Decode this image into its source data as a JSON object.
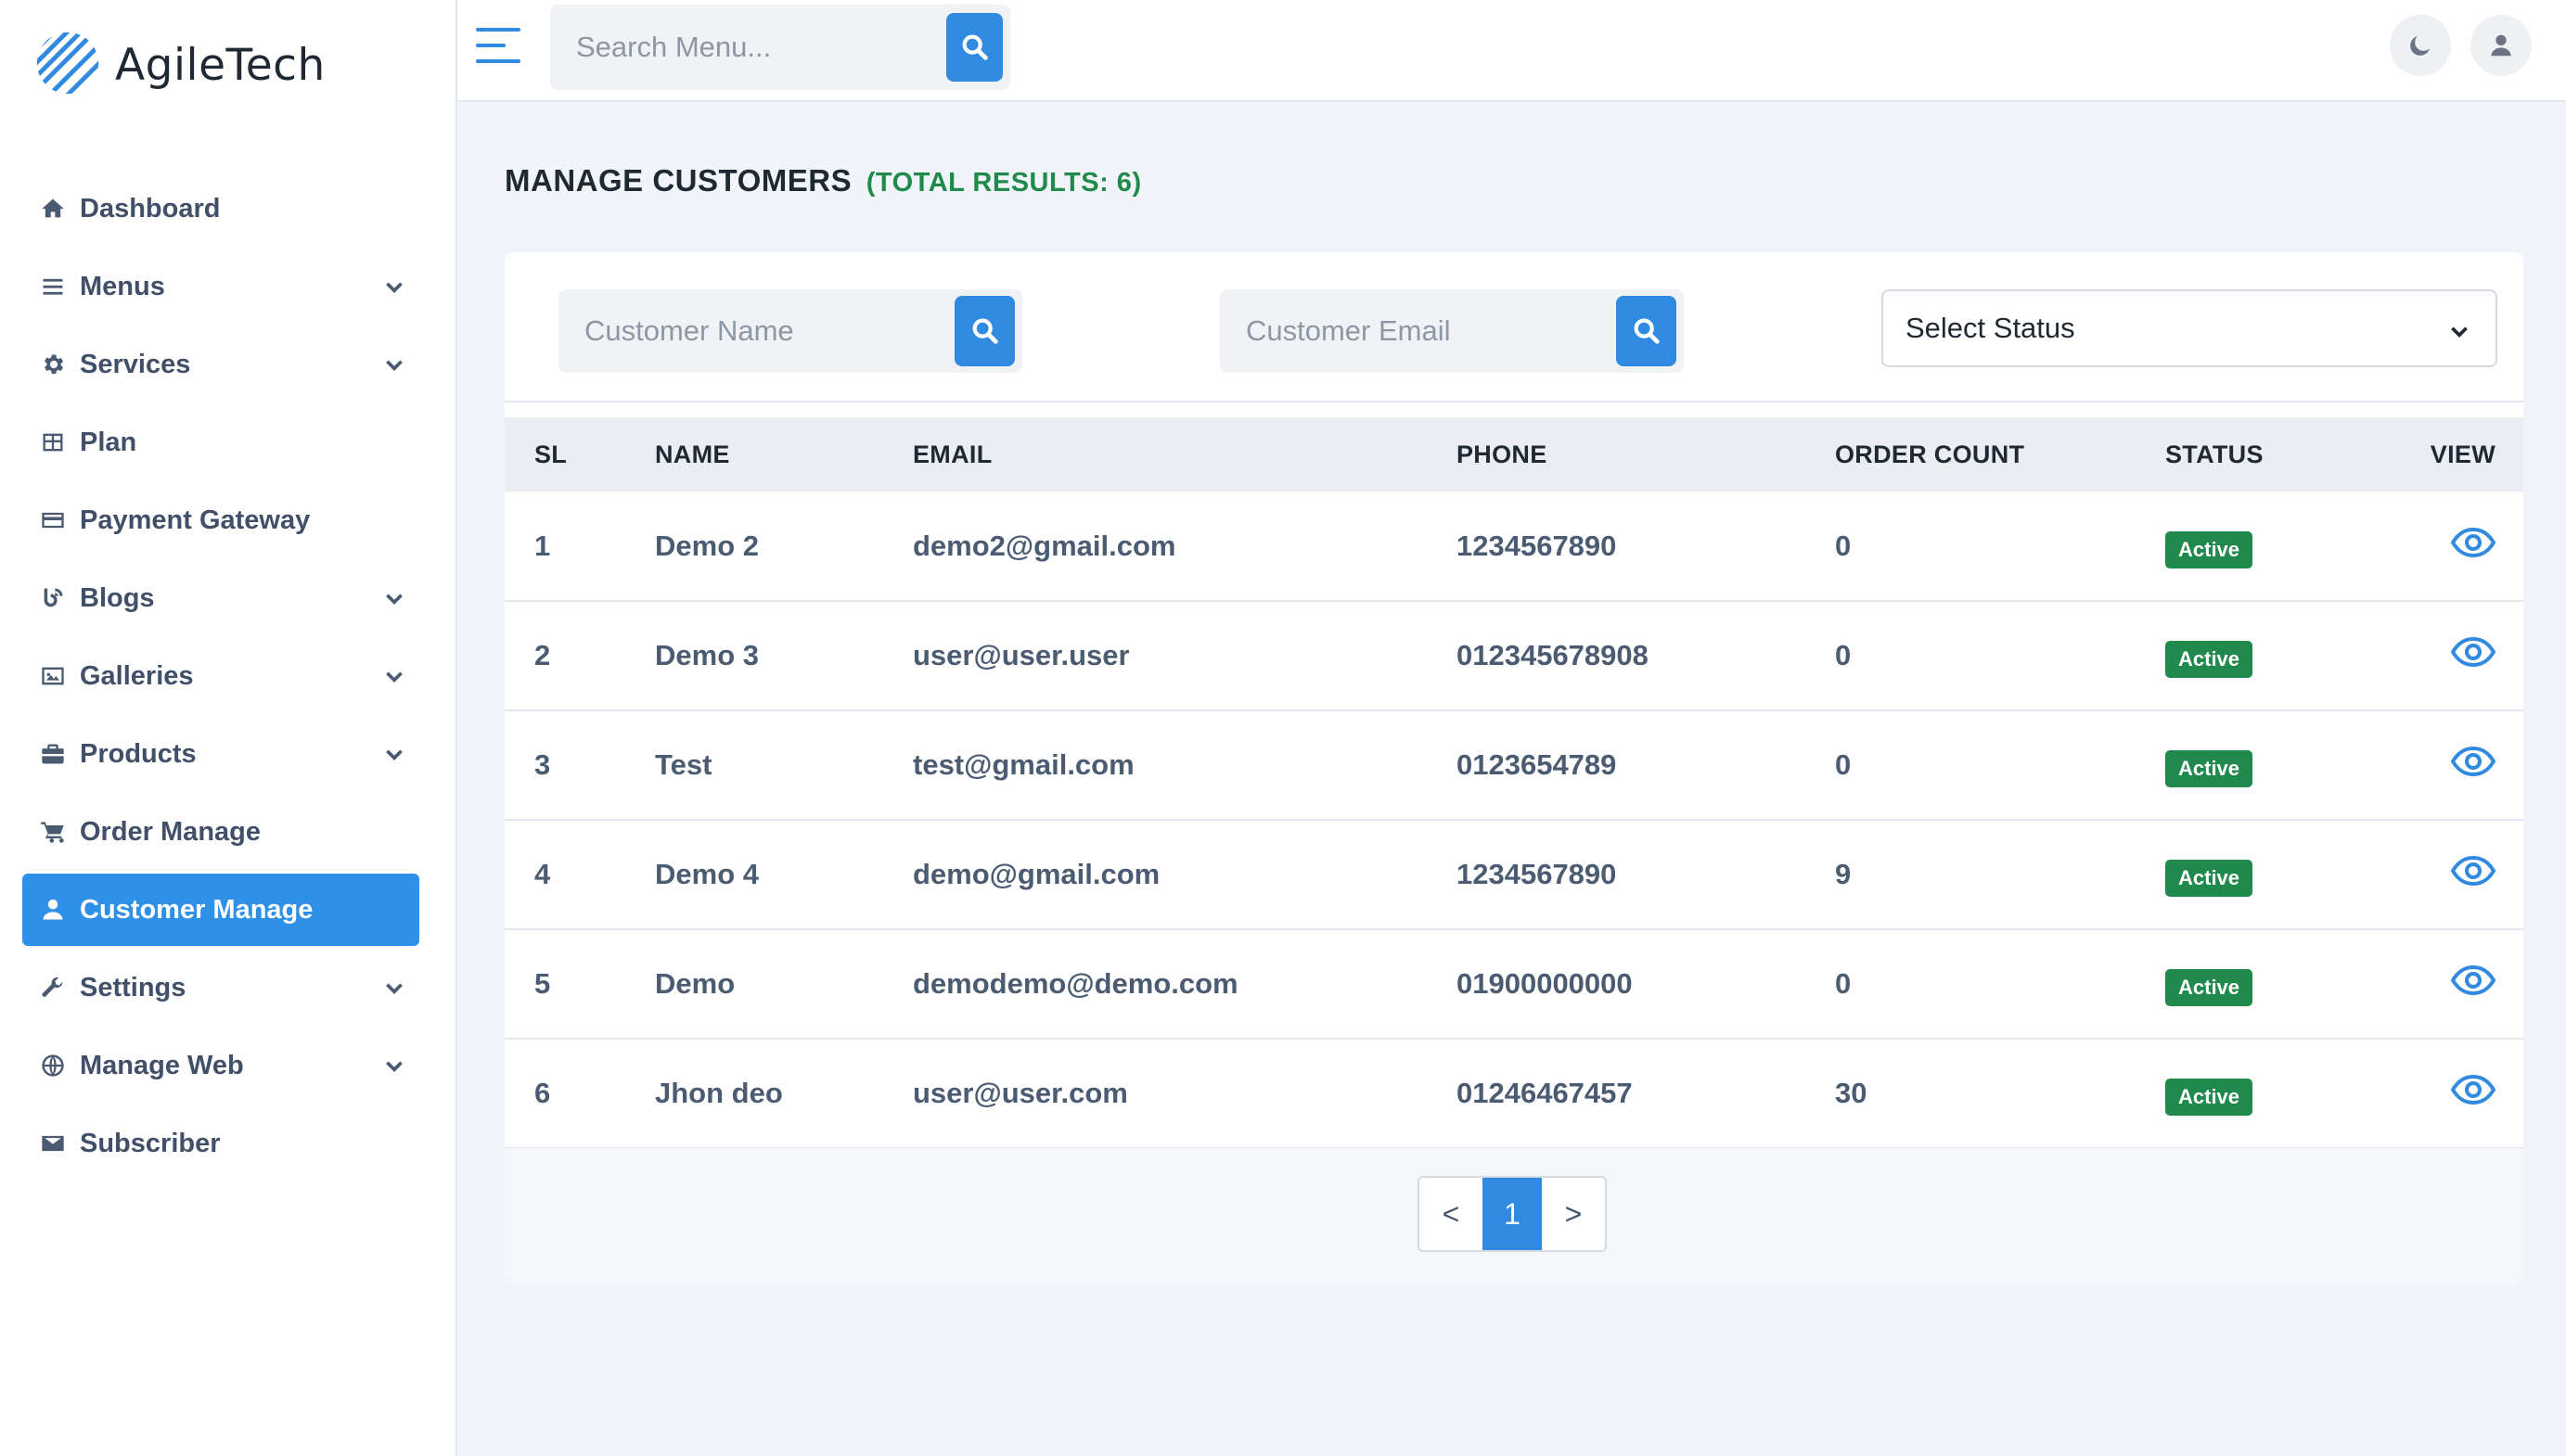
{
  "brand": {
    "name": "AgileTech"
  },
  "topbar": {
    "search_placeholder": "Search Menu...",
    "theme_toggle_icon": "moon-icon",
    "profile_icon": "user-icon"
  },
  "sidebar": {
    "items": [
      {
        "label": "Dashboard",
        "icon": "home-icon",
        "expandable": false,
        "active": false
      },
      {
        "label": "Menus",
        "icon": "menu-icon",
        "expandable": true,
        "active": false
      },
      {
        "label": "Services",
        "icon": "gear-icon",
        "expandable": true,
        "active": false
      },
      {
        "label": "Plan",
        "icon": "table-icon",
        "expandable": false,
        "active": false
      },
      {
        "label": "Payment Gateway",
        "icon": "credit-card-icon",
        "expandable": false,
        "active": false
      },
      {
        "label": "Blogs",
        "icon": "blog-icon",
        "expandable": true,
        "active": false
      },
      {
        "label": "Galleries",
        "icon": "image-icon",
        "expandable": true,
        "active": false
      },
      {
        "label": "Products",
        "icon": "briefcase-icon",
        "expandable": true,
        "active": false
      },
      {
        "label": "Order Manage",
        "icon": "cart-icon",
        "expandable": false,
        "active": false
      },
      {
        "label": "Customer Manage",
        "icon": "user-icon",
        "expandable": false,
        "active": true
      },
      {
        "label": "Settings",
        "icon": "wrench-icon",
        "expandable": true,
        "active": false
      },
      {
        "label": "Manage Web",
        "icon": "globe-icon",
        "expandable": true,
        "active": false
      },
      {
        "label": "Subscriber",
        "icon": "envelope-icon",
        "expandable": false,
        "active": false
      }
    ]
  },
  "page": {
    "title": "MANAGE CUSTOMERS",
    "total_results": "(TOTAL RESULTS: 6)"
  },
  "filters": {
    "name_placeholder": "Customer Name",
    "email_placeholder": "Customer Email",
    "status_select": "Select Status"
  },
  "table": {
    "columns": [
      "SL",
      "NAME",
      "EMAIL",
      "PHONE",
      "ORDER COUNT",
      "STATUS",
      "VIEW"
    ],
    "rows": [
      {
        "sl": "1",
        "name": "Demo 2",
        "email": "demo2@gmail.com",
        "phone": "1234567890",
        "order_count": "0",
        "status": "Active"
      },
      {
        "sl": "2",
        "name": "Demo 3",
        "email": "user@user.user",
        "phone": "012345678908",
        "order_count": "0",
        "status": "Active"
      },
      {
        "sl": "3",
        "name": "Test",
        "email": "test@gmail.com",
        "phone": "0123654789",
        "order_count": "0",
        "status": "Active"
      },
      {
        "sl": "4",
        "name": "Demo 4",
        "email": "demo@gmail.com",
        "phone": "1234567890",
        "order_count": "9",
        "status": "Active"
      },
      {
        "sl": "5",
        "name": "Demo",
        "email": "demodemo@demo.com",
        "phone": "01900000000",
        "order_count": "0",
        "status": "Active"
      },
      {
        "sl": "6",
        "name": "Jhon deo",
        "email": "user@user.com",
        "phone": "01246467457",
        "order_count": "30",
        "status": "Active"
      }
    ]
  },
  "pagination": {
    "prev": "<",
    "current": "1",
    "next": ">"
  },
  "colors": {
    "accent": "#2f8ae0",
    "active_badge": "#1f8a4c",
    "total_results": "#1f8a4c"
  }
}
